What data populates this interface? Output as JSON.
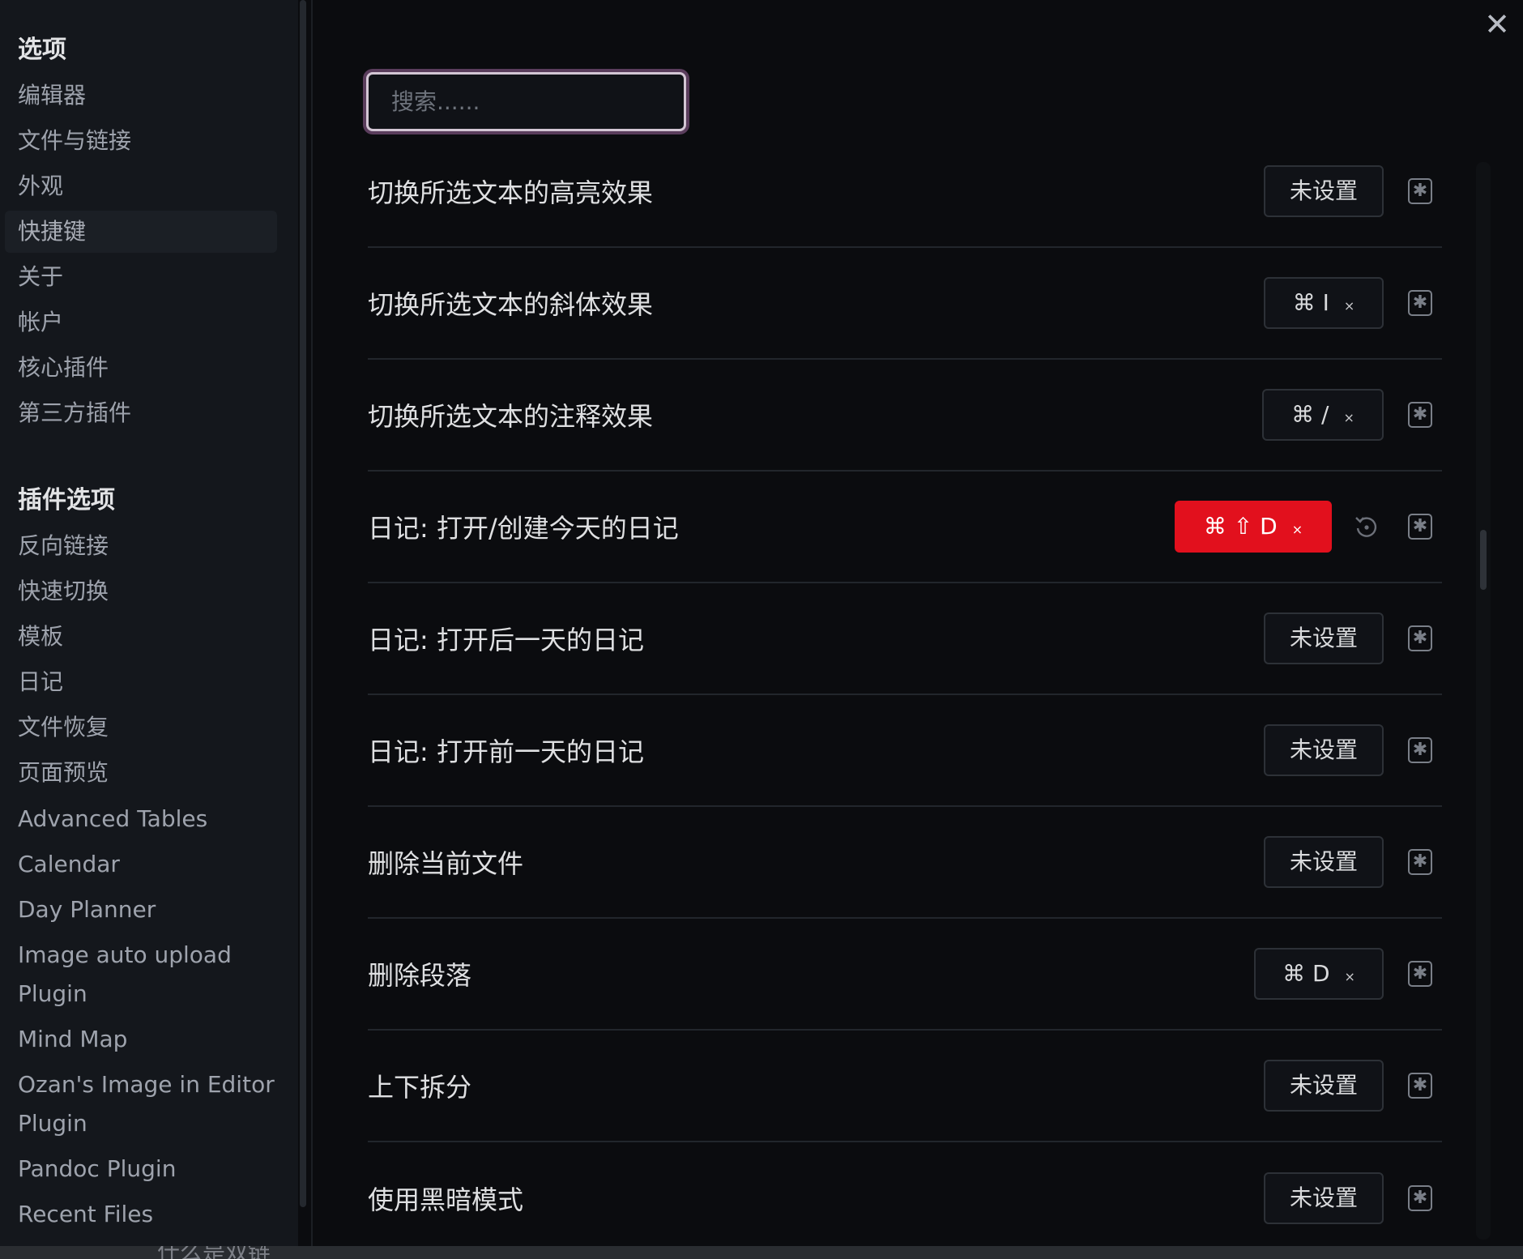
{
  "sidebar": {
    "options_heading": "选项",
    "options_items": [
      {
        "label": "编辑器"
      },
      {
        "label": "文件与链接"
      },
      {
        "label": "外观"
      },
      {
        "label": "快捷键"
      },
      {
        "label": "关于"
      },
      {
        "label": "帐户"
      },
      {
        "label": "核心插件"
      },
      {
        "label": "第三方插件"
      }
    ],
    "plugin_heading": "插件选项",
    "plugin_items": [
      {
        "label": "反向链接"
      },
      {
        "label": "快速切换"
      },
      {
        "label": "模板"
      },
      {
        "label": "日记"
      },
      {
        "label": "文件恢复"
      },
      {
        "label": "页面预览"
      },
      {
        "label": "Advanced Tables"
      },
      {
        "label": "Calendar"
      },
      {
        "label": "Day Planner"
      },
      {
        "label": "Image auto upload Plugin"
      },
      {
        "label": "Mind Map"
      },
      {
        "label": "Ozan's Image in Editor Plugin"
      },
      {
        "label": "Pandoc Plugin"
      },
      {
        "label": "Recent Files"
      }
    ],
    "active_item": "快捷键"
  },
  "search": {
    "placeholder": "搜索......",
    "value": ""
  },
  "close_label": "✕",
  "hotkeys": [
    {
      "title": "切换所选文本的高亮效果",
      "hotkey": "未设置",
      "removable": false
    },
    {
      "title": "切换所选文本的斜体效果",
      "hotkey": "⌘ I",
      "removable": true,
      "remove": "×"
    },
    {
      "title": "切换所选文本的注释效果",
      "hotkey": "⌘ /",
      "removable": true,
      "remove": "×"
    },
    {
      "title": "日记: 打开/创建今天的日记",
      "hotkey": "⌘ ⇧ D",
      "removable": true,
      "remove": "×",
      "conflict": true
    },
    {
      "title": "日记: 打开后一天的日记",
      "hotkey": "未设置",
      "removable": false
    },
    {
      "title": "日记: 打开前一天的日记",
      "hotkey": "未设置",
      "removable": false
    },
    {
      "title": "删除当前文件",
      "hotkey": "未设置",
      "removable": false
    },
    {
      "title": "删除段落",
      "hotkey": "⌘ D",
      "removable": true,
      "remove": "×"
    },
    {
      "title": "上下拆分",
      "hotkey": "未设置",
      "removable": false
    },
    {
      "title": "使用黑暗模式",
      "hotkey": "未设置",
      "removable": false
    }
  ],
  "add_icon_glyph": "✱",
  "icons": {
    "add": "add-hotkey-icon",
    "restore": "restore-default-icon",
    "close": "close-icon"
  },
  "colors": {
    "conflict": "#e2101d",
    "accent_focus": "#d3c6d4"
  },
  "bottom_text": "什么是双链"
}
